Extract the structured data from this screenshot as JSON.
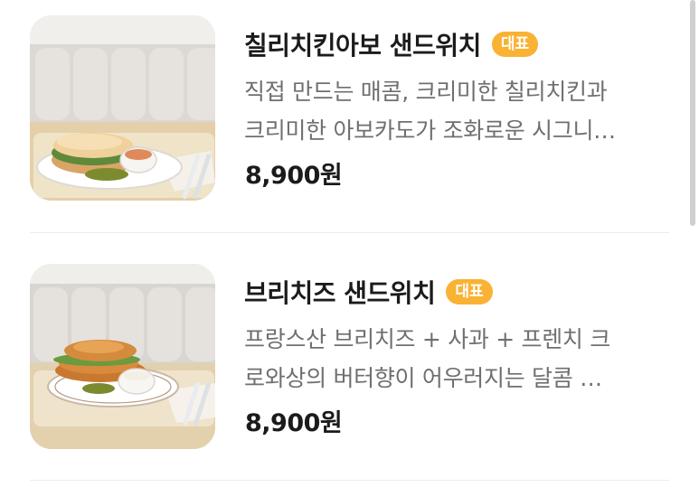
{
  "menu_items": [
    {
      "name": "칠리치킨아보 샌드위치",
      "badge": "대표",
      "description_line1": "직접 만드는 매콤, 크리미한 칠리치킨과",
      "description_line2": "크리미한 아보카도가 조화로운 시그니…",
      "price": "8,900원",
      "image": "chili-chicken-avocado-sandwich-photo"
    },
    {
      "name": "브리치즈 샌드위치",
      "badge": "대표",
      "description_line1": "프랑스산 브리치즈 + 사과 + 프렌치 크",
      "description_line2": "로와상의 버터향이 어우러지는 달콤 …",
      "price": "8,900원",
      "image": "brie-cheese-croissant-sandwich-photo"
    }
  ],
  "colors": {
    "badge": "#f9b233",
    "title": "#1b1b1b",
    "description": "#6f6f6f",
    "divider": "#ececec"
  }
}
